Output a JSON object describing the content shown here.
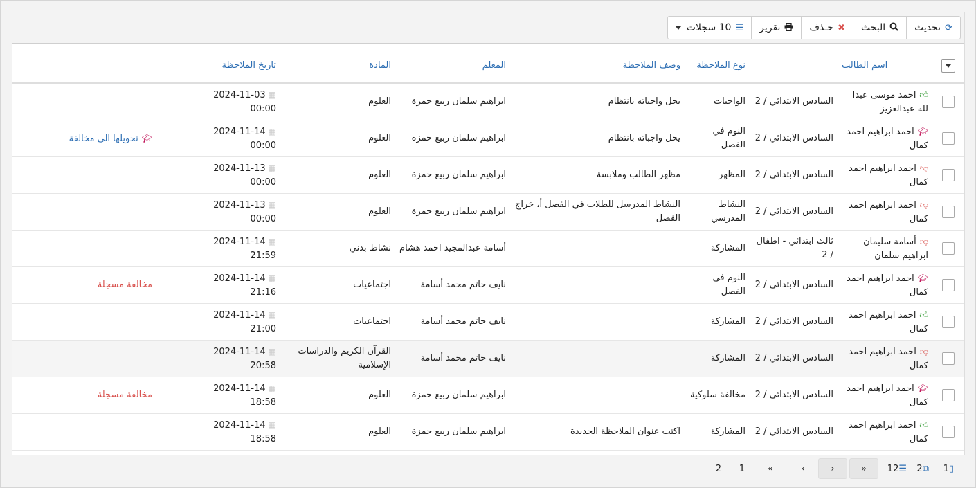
{
  "toolbar": {
    "refresh_label": "تحديث",
    "search_label": "البحث",
    "delete_label": "حـذف",
    "report_label": "تقرير",
    "records_label": "10 سجلات"
  },
  "columns": {
    "student": "اسم الطالب",
    "note_type": "نوع الملاحظة",
    "note_desc": "وصف الملاحظة",
    "teacher": "المعلم",
    "subject": "المادة",
    "note_date": "تاريخ الملاحظة"
  },
  "rows": [
    {
      "icon": "thumbs-up",
      "student": "احمد موسى عبدا لله عبدالعزيز",
      "class": "السادس الابتدائي / 2",
      "type": "الواجبات",
      "desc": "يحل واجباته بانتظام",
      "teacher": "ابراهيم سلمان ربيع حمزة",
      "subject": "العلوم",
      "date": "2024-11-03",
      "time": "00:00",
      "status": "",
      "status_color": ""
    },
    {
      "icon": "graduation-cap",
      "student": "احمد ابراهيم احمد كمال",
      "class": "السادس الابتدائي / 2",
      "type": "النوم في الفصل",
      "desc": "يحل واجباته بانتظام",
      "teacher": "ابراهيم سلمان ربيع حمزة",
      "subject": "العلوم",
      "date": "2024-11-14",
      "time": "00:00",
      "status": "تحويلها الى مخالفة",
      "status_color": "blue"
    },
    {
      "icon": "thumbs-down",
      "student": "احمد ابراهيم احمد كمال",
      "class": "السادس الابتدائي / 2",
      "type": "المظهر",
      "desc": "مظهر الطالب وملابسة",
      "teacher": "ابراهيم سلمان ربيع حمزة",
      "subject": "العلوم",
      "date": "2024-11-13",
      "time": "00:00",
      "status": "",
      "status_color": ""
    },
    {
      "icon": "thumbs-down",
      "student": "احمد ابراهيم احمد كمال",
      "class": "السادس الابتدائي / 2",
      "type": "النشاط المدرسي",
      "desc": "النشاط المدرسل للطلاب في الفصل أ، خراج الفصل",
      "teacher": "ابراهيم سلمان ربيع حمزة",
      "subject": "العلوم",
      "date": "2024-11-13",
      "time": "00:00",
      "status": "",
      "status_color": ""
    },
    {
      "icon": "thumbs-down",
      "student": "أسامة سليمان ابراهيم سلمان",
      "class": "ثالث ابتدائي - اطفال / 2",
      "type": "المشاركة",
      "desc": "",
      "teacher": "أسامة عبدالمجيد احمد هشام",
      "subject": "نشاط بدني",
      "date": "2024-11-14",
      "time": "21:59",
      "status": "",
      "status_color": ""
    },
    {
      "icon": "graduation-cap",
      "student": "احمد ابراهيم احمد كمال",
      "class": "السادس الابتدائي / 2",
      "type": "النوم في الفصل",
      "desc": "",
      "teacher": "نايف حاتم محمد أسامة",
      "subject": "اجتماعيات",
      "date": "2024-11-14",
      "time": "21:16",
      "status": "مخالفة مسجلة",
      "status_color": "red"
    },
    {
      "icon": "thumbs-up",
      "student": "احمد ابراهيم احمد كمال",
      "class": "السادس الابتدائي / 2",
      "type": "المشاركة",
      "desc": "",
      "teacher": "نايف حاتم محمد أسامة",
      "subject": "اجتماعيات",
      "date": "2024-11-14",
      "time": "21:00",
      "status": "",
      "status_color": ""
    },
    {
      "icon": "thumbs-down",
      "student": "احمد ابراهيم احمد كمال",
      "class": "السادس الابتدائي / 2",
      "type": "المشاركة",
      "desc": "",
      "teacher": "نايف حاتم محمد أسامة",
      "subject": "القرآن الكريم والدراسات الإسلامية",
      "date": "2024-11-14",
      "time": "20:58",
      "status": "",
      "status_color": "",
      "highlight": true
    },
    {
      "icon": "graduation-cap",
      "student": "احمد ابراهيم احمد كمال",
      "class": "السادس الابتدائي / 2",
      "type": "مخالفة سلوكية",
      "desc": "",
      "teacher": "ابراهيم سلمان ربيع حمزة",
      "subject": "العلوم",
      "date": "2024-11-14",
      "time": "18:58",
      "status": "مخالفة مسجلة",
      "status_color": "red"
    },
    {
      "icon": "thumbs-up",
      "student": "احمد ابراهيم احمد كمال",
      "class": "السادس الابتدائي / 2",
      "type": "المشاركة",
      "desc": "اكتب عنوان الملاحظة الجديدة",
      "teacher": "ابراهيم سلمان ربيع حمزة",
      "subject": "العلوم",
      "date": "2024-11-14",
      "time": "18:58",
      "status": "",
      "status_color": ""
    }
  ],
  "pager": {
    "current_page": "1",
    "total_pages": "2",
    "total_records": "12",
    "prev_first_glyph": "«",
    "prev_glyph": "‹",
    "next_glyph": "›",
    "last_glyph": "»",
    "page_1": "1",
    "page_2": "2"
  },
  "colors": {
    "link_blue": "#2e6fb4",
    "danger_red": "#d9534f",
    "success_green": "#3a9d3a",
    "cap_pink": "#c2185b"
  }
}
